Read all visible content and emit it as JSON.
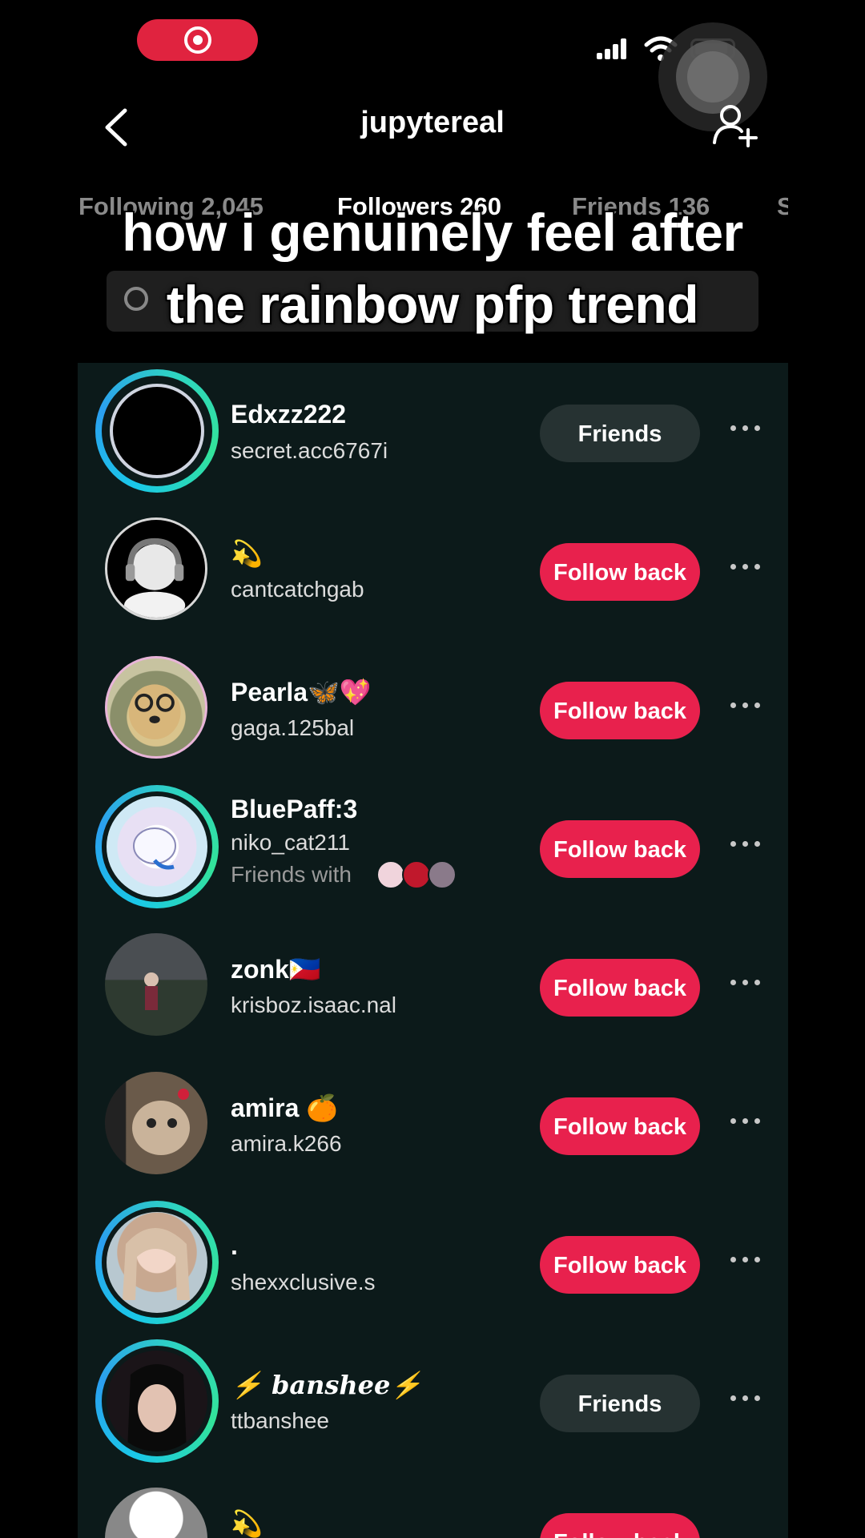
{
  "header": {
    "title": "jupytereal"
  },
  "tabs": [
    {
      "label": "Following 2,045"
    },
    {
      "label": "Followers 260"
    },
    {
      "label": "Friends 136"
    },
    {
      "label": "S"
    }
  ],
  "caption": {
    "line1": "how i genuinely feel after",
    "line2": "the rainbow pfp trend"
  },
  "rows": [
    {
      "name": "Edxzz222",
      "handle": "secret.acc6767i",
      "button": "Friends"
    },
    {
      "name": "💫",
      "handle": "cantcatchgab",
      "button": "Follow back"
    },
    {
      "name": "Pearla🦋💖",
      "handle": "gaga.125bal",
      "button": "Follow back"
    },
    {
      "name": "BluePaff:3",
      "handle": "niko_cat211",
      "sub": "Friends with",
      "button": "Follow back"
    },
    {
      "name": "zonk🇵🇭",
      "handle": "krisboz.isaac.nal",
      "button": "Follow back"
    },
    {
      "name": "amira 🍊",
      "handle": "amira.k266",
      "button": "Follow back"
    },
    {
      "name": ".",
      "handle": "shexxclusive.s",
      "button": "Follow back"
    },
    {
      "name": "⚡ banshee⚡",
      "handle": "ttbanshee",
      "button": "Friends"
    },
    {
      "name": "💫",
      "handle": "",
      "button": "Follow back"
    }
  ],
  "colors": {
    "follow_button": "#e8214d",
    "friends_button": "#263232",
    "list_background": "#0c1a1a",
    "ring_gradient": "#1ac8e8"
  },
  "icons": [
    "back-arrow-icon",
    "add-user-icon",
    "search-icon",
    "more-options-icon",
    "signal-icon",
    "wifi-icon",
    "battery-icon",
    "screen-record-icon"
  ]
}
